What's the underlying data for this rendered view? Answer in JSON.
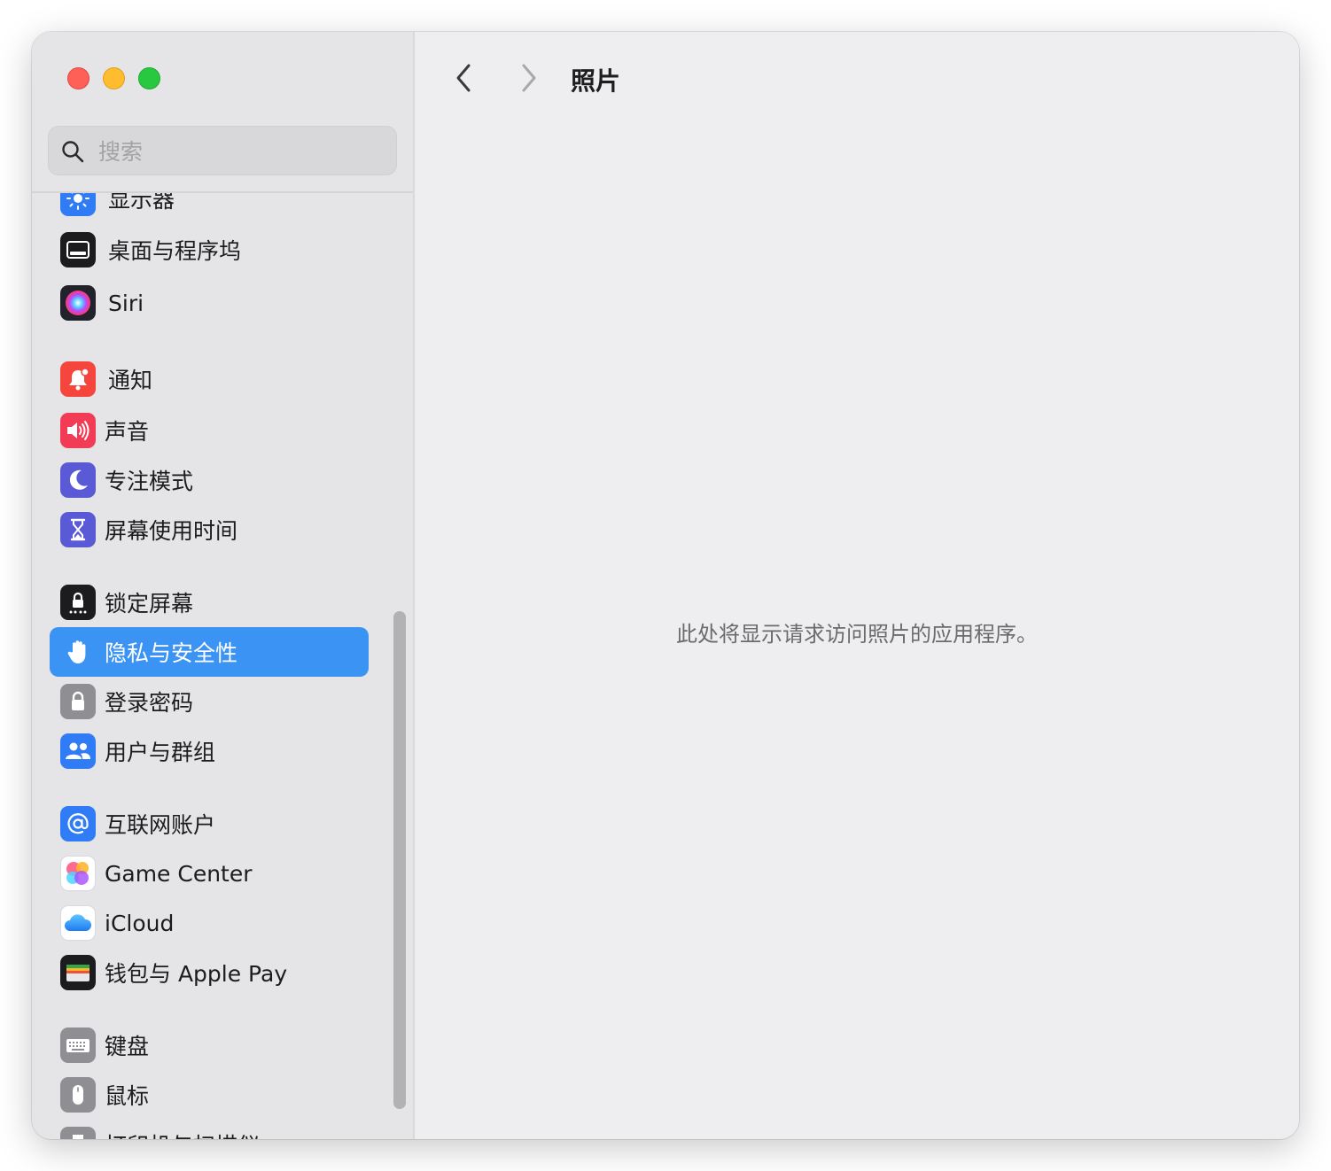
{
  "search": {
    "placeholder": "搜索",
    "value": ""
  },
  "sidebar": {
    "items": [
      {
        "label": "显示器",
        "icon": "display-icon",
        "color": "#2f7cf6"
      },
      {
        "label": "桌面与程序坞",
        "icon": "dock-icon",
        "color": "#1c1c1e"
      },
      {
        "label": "Siri",
        "icon": "siri-icon",
        "color": "#2b2b3a"
      },
      {
        "label": "通知",
        "icon": "bell-icon",
        "color": "#f5453d"
      },
      {
        "label": "声音",
        "icon": "speaker-icon",
        "color": "#f23b55"
      },
      {
        "label": "专注模式",
        "icon": "moon-icon",
        "color": "#5b5ad6"
      },
      {
        "label": "屏幕使用时间",
        "icon": "hourglass-icon",
        "color": "#5b5ad6"
      },
      {
        "label": "锁定屏幕",
        "icon": "lock-screen-icon",
        "color": "#1c1c1e"
      },
      {
        "label": "隐私与安全性",
        "icon": "hand-icon",
        "color": "#3b93f3",
        "selected": true
      },
      {
        "label": "登录密码",
        "icon": "lock-icon",
        "color": "#8e8e93"
      },
      {
        "label": "用户与群组",
        "icon": "users-icon",
        "color": "#2f7cf6"
      },
      {
        "label": "互联网账户",
        "icon": "at-icon",
        "color": "#2f7cf6"
      },
      {
        "label": "Game Center",
        "icon": "game-center-icon",
        "color": "#ffffff"
      },
      {
        "label": "iCloud",
        "icon": "cloud-icon",
        "color": "#ffffff"
      },
      {
        "label": "钱包与 Apple Pay",
        "icon": "wallet-icon",
        "color": "#1c1c1e"
      },
      {
        "label": "键盘",
        "icon": "keyboard-icon",
        "color": "#8e8e93"
      },
      {
        "label": "鼠标",
        "icon": "mouse-icon",
        "color": "#8e8e93"
      },
      {
        "label": "打印机与扫描仪",
        "icon": "printer-icon",
        "color": "#8e8e93"
      }
    ]
  },
  "header": {
    "title": "照片"
  },
  "main": {
    "empty_message": "此处将显示请求访问照片的应用程序。"
  },
  "colors": {
    "accent": "#3b93f3",
    "sidebar_bg": "#e5e5e8",
    "content_bg": "#eeeef1"
  }
}
